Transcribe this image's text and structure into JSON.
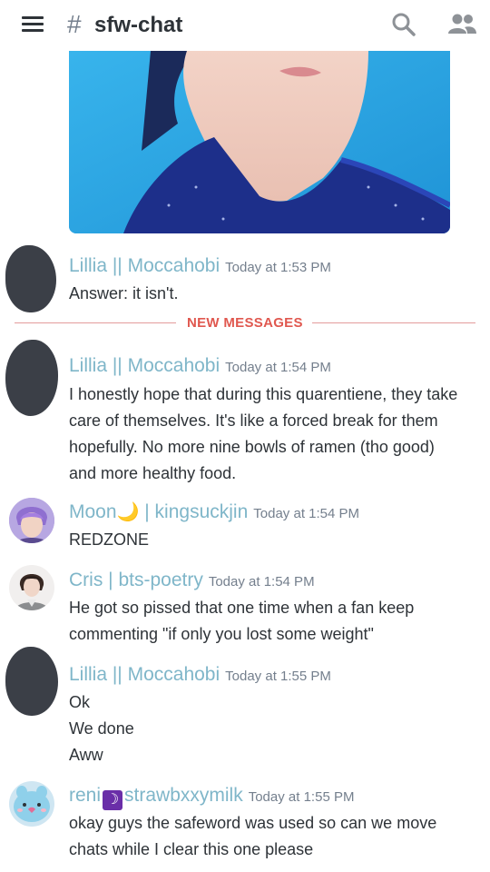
{
  "header": {
    "hash_symbol": "#",
    "channel_name": "sfw-chat",
    "icons": {
      "menu": "hamburger-icon",
      "search": "search-icon",
      "members": "members-icon"
    }
  },
  "divider": {
    "label": "NEW MESSAGES",
    "color": "#e0584f"
  },
  "colors": {
    "username": "#7fb6c9",
    "text": "#2e3338",
    "timestamp": "#747f8d"
  },
  "messages": [
    {
      "username": "Lillia || Moccahobi",
      "timestamp": "Today at 1:53 PM",
      "lines": [
        "Answer: it isn't."
      ]
    },
    {
      "username": "Lillia || Moccahobi",
      "timestamp": "Today at 1:54 PM",
      "lines": [
        "I honestly hope that during this quarentiene, they take care of themselves. It's like a forced break for them hopefully. No more nine bowls of ramen (tho good) and more healthy food."
      ]
    },
    {
      "username_part1": "Moon",
      "username_emoji": "🌙",
      "username_part2": " | kingsuckjin",
      "timestamp": "Today at 1:54 PM",
      "lines": [
        "REDZONE"
      ]
    },
    {
      "username": "Cris | bts-poetry",
      "timestamp": "Today at 1:54 PM",
      "lines": [
        "He got so pissed that one time when a fan keep commenting \"if only you lost some weight\""
      ]
    },
    {
      "username": "Lillia || Moccahobi",
      "timestamp": "Today at 1:55 PM",
      "lines": [
        "Ok",
        "We done",
        "Aww"
      ]
    },
    {
      "username_part1": "reni",
      "username_emoji": "☽",
      "username_part2": "strawbxxymilk",
      "timestamp": "Today at 1:55 PM",
      "lines": [
        "okay guys the safeword was used so can we move chats while I clear this one please"
      ]
    }
  ]
}
